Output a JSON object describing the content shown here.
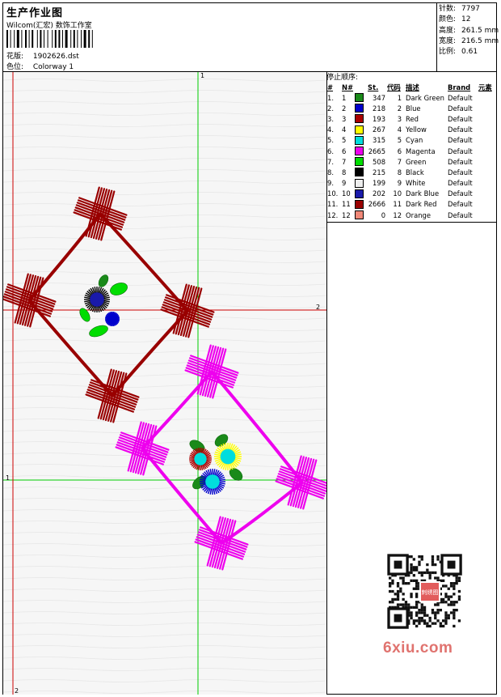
{
  "header": {
    "title": "生产作业图",
    "subtitle": "Wilcom(汇宏) 数饰工作室",
    "design_label": "花版:",
    "design_value": "1902626.dst",
    "colorway_label": "色位:",
    "colorway_value": "Colorway 1"
  },
  "stats": [
    {
      "label": "针数:",
      "value": "7797"
    },
    {
      "label": "颜色:",
      "value": "12"
    },
    {
      "label": "高度:",
      "value": "261.5 mm"
    },
    {
      "label": "宽度:",
      "value": "216.5 mm"
    },
    {
      "label": "比例:",
      "value": "0.61"
    }
  ],
  "stop_sequence": {
    "title": "停止顺序:",
    "headers": {
      "no": "#",
      "n": "N#",
      "st": "St.",
      "code": "代码",
      "desc": "描述",
      "brand": "Brand",
      "element": "元素"
    },
    "rows": [
      {
        "no": "1.",
        "n": "1",
        "color": "#1a8a1a",
        "st": "347",
        "code": "1",
        "desc": "Dark Green",
        "brand": "Default"
      },
      {
        "no": "2.",
        "n": "2",
        "color": "#0000cc",
        "st": "218",
        "code": "2",
        "desc": "Blue",
        "brand": "Default"
      },
      {
        "no": "3.",
        "n": "3",
        "color": "#aa0000",
        "st": "193",
        "code": "3",
        "desc": "Red",
        "brand": "Default"
      },
      {
        "no": "4.",
        "n": "4",
        "color": "#ffff00",
        "st": "267",
        "code": "4",
        "desc": "Yellow",
        "brand": "Default"
      },
      {
        "no": "5.",
        "n": "5",
        "color": "#00dddd",
        "st": "315",
        "code": "5",
        "desc": "Cyan",
        "brand": "Default"
      },
      {
        "no": "6.",
        "n": "6",
        "color": "#ee00ee",
        "st": "2665",
        "code": "6",
        "desc": "Magenta",
        "brand": "Default"
      },
      {
        "no": "7.",
        "n": "7",
        "color": "#00dd00",
        "st": "508",
        "code": "7",
        "desc": "Green",
        "brand": "Default"
      },
      {
        "no": "8.",
        "n": "8",
        "color": "#000000",
        "st": "215",
        "code": "8",
        "desc": "Black",
        "brand": "Default"
      },
      {
        "no": "9.",
        "n": "9",
        "color": "#eeeeee",
        "st": "199",
        "code": "9",
        "desc": "White",
        "brand": "Default"
      },
      {
        "no": "10.",
        "n": "10",
        "color": "#1a1aaa",
        "st": "202",
        "code": "10",
        "desc": "Dark Blue",
        "brand": "Default"
      },
      {
        "no": "11.",
        "n": "11",
        "color": "#990000",
        "st": "2666",
        "code": "11",
        "desc": "Dark Red",
        "brand": "Default"
      },
      {
        "no": "12.",
        "n": "12",
        "color": "#f08878",
        "st": "0",
        "code": "12",
        "desc": "Orange",
        "brand": "Default"
      }
    ]
  },
  "guides": {
    "top": "1",
    "right": "2",
    "left": "1",
    "bottom": "2"
  },
  "colors": {
    "guide_green": "#00cc00",
    "guide_red": "#cc0000",
    "motif_dark_red": "#990000",
    "motif_magenta": "#ee00ee"
  },
  "watermark": {
    "text": "6xiu.com",
    "qr_caption": "刺绣图"
  }
}
